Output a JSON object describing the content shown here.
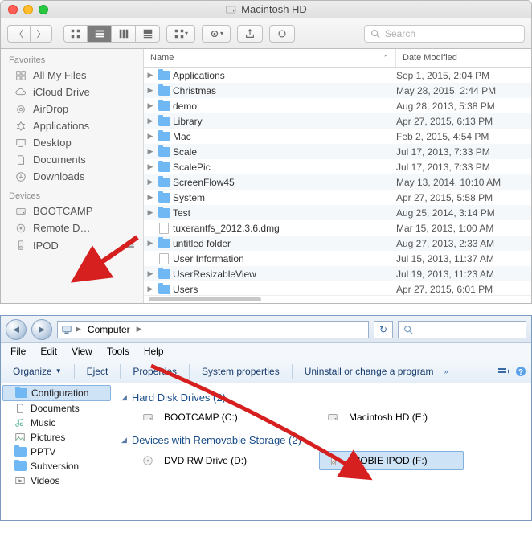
{
  "mac": {
    "title": "Macintosh HD",
    "search_placeholder": "Search",
    "sidebar": {
      "favorites_label": "Favorites",
      "devices_label": "Devices",
      "favorites": [
        {
          "label": "All My Files",
          "icon": "all-files"
        },
        {
          "label": "iCloud Drive",
          "icon": "icloud"
        },
        {
          "label": "AirDrop",
          "icon": "airdrop"
        },
        {
          "label": "Applications",
          "icon": "applications"
        },
        {
          "label": "Desktop",
          "icon": "desktop"
        },
        {
          "label": "Documents",
          "icon": "documents"
        },
        {
          "label": "Downloads",
          "icon": "downloads"
        }
      ],
      "devices": [
        {
          "label": "BOOTCAMP",
          "icon": "hdd",
          "eject": false
        },
        {
          "label": "Remote D…",
          "icon": "remote-disc",
          "eject": false
        },
        {
          "label": "IPOD",
          "icon": "ipod",
          "eject": true
        }
      ]
    },
    "columns": {
      "name": "Name",
      "date": "Date Modified"
    },
    "files": [
      {
        "name": "Applications",
        "type": "folder",
        "date": "Sep 1, 2015, 2:04 PM"
      },
      {
        "name": "Christmas",
        "type": "folder",
        "date": "May 28, 2015, 2:44 PM"
      },
      {
        "name": "demo",
        "type": "folder",
        "date": "Aug 28, 2013, 5:38 PM"
      },
      {
        "name": "Library",
        "type": "folder",
        "date": "Apr 27, 2015, 6:13 PM"
      },
      {
        "name": "Mac",
        "type": "folder",
        "date": "Feb 2, 2015, 4:54 PM"
      },
      {
        "name": "Scale",
        "type": "folder",
        "date": "Jul 17, 2013, 7:33 PM"
      },
      {
        "name": "ScalePic",
        "type": "folder",
        "date": "Jul 17, 2013, 7:33 PM"
      },
      {
        "name": "ScreenFlow45",
        "type": "folder",
        "date": "May 13, 2014, 10:10 AM"
      },
      {
        "name": "System",
        "type": "folder",
        "date": "Apr 27, 2015, 5:58 PM"
      },
      {
        "name": "Test",
        "type": "folder",
        "date": "Aug 25, 2014, 3:14 PM"
      },
      {
        "name": "tuxerantfs_2012.3.6.dmg",
        "type": "file",
        "date": "Mar 15, 2013, 1:00 AM"
      },
      {
        "name": "untitled folder",
        "type": "folder",
        "date": "Aug 27, 2013, 2:33 AM"
      },
      {
        "name": "User Information",
        "type": "file",
        "date": "Jul 15, 2013, 11:37 AM"
      },
      {
        "name": "UserResizableView",
        "type": "folder",
        "date": "Jul 19, 2013, 11:23 AM"
      },
      {
        "name": "Users",
        "type": "folder",
        "date": "Apr 27, 2015, 6:01 PM"
      }
    ]
  },
  "win": {
    "breadcrumb": {
      "root": "Computer"
    },
    "menu": [
      "File",
      "Edit",
      "View",
      "Tools",
      "Help"
    ],
    "commands": {
      "organize": "Organize",
      "eject": "Eject",
      "properties": "Properties",
      "sysprops": "System properties",
      "uninstall": "Uninstall or change a program"
    },
    "tree": [
      {
        "label": "Configuration",
        "icon": "folder",
        "sel": true
      },
      {
        "label": "Documents",
        "icon": "doc"
      },
      {
        "label": "Music",
        "icon": "music"
      },
      {
        "label": "Pictures",
        "icon": "pictures"
      },
      {
        "label": "PPTV",
        "icon": "folder"
      },
      {
        "label": "Subversion",
        "icon": "folder"
      },
      {
        "label": "Videos",
        "icon": "video"
      }
    ],
    "groups": {
      "hdd": {
        "label": "Hard Disk Drives (2)",
        "drives": [
          {
            "label": "BOOTCAMP (C:)",
            "icon": "hdd"
          },
          {
            "label": "Macintosh HD (E:)",
            "icon": "hdd"
          }
        ]
      },
      "removable": {
        "label": "Devices with Removable Storage (2)",
        "drives": [
          {
            "label": "DVD RW Drive (D:)",
            "icon": "dvd"
          },
          {
            "label": "IMOBIE IPOD (F:)",
            "icon": "ipod",
            "sel": true
          }
        ]
      }
    }
  }
}
